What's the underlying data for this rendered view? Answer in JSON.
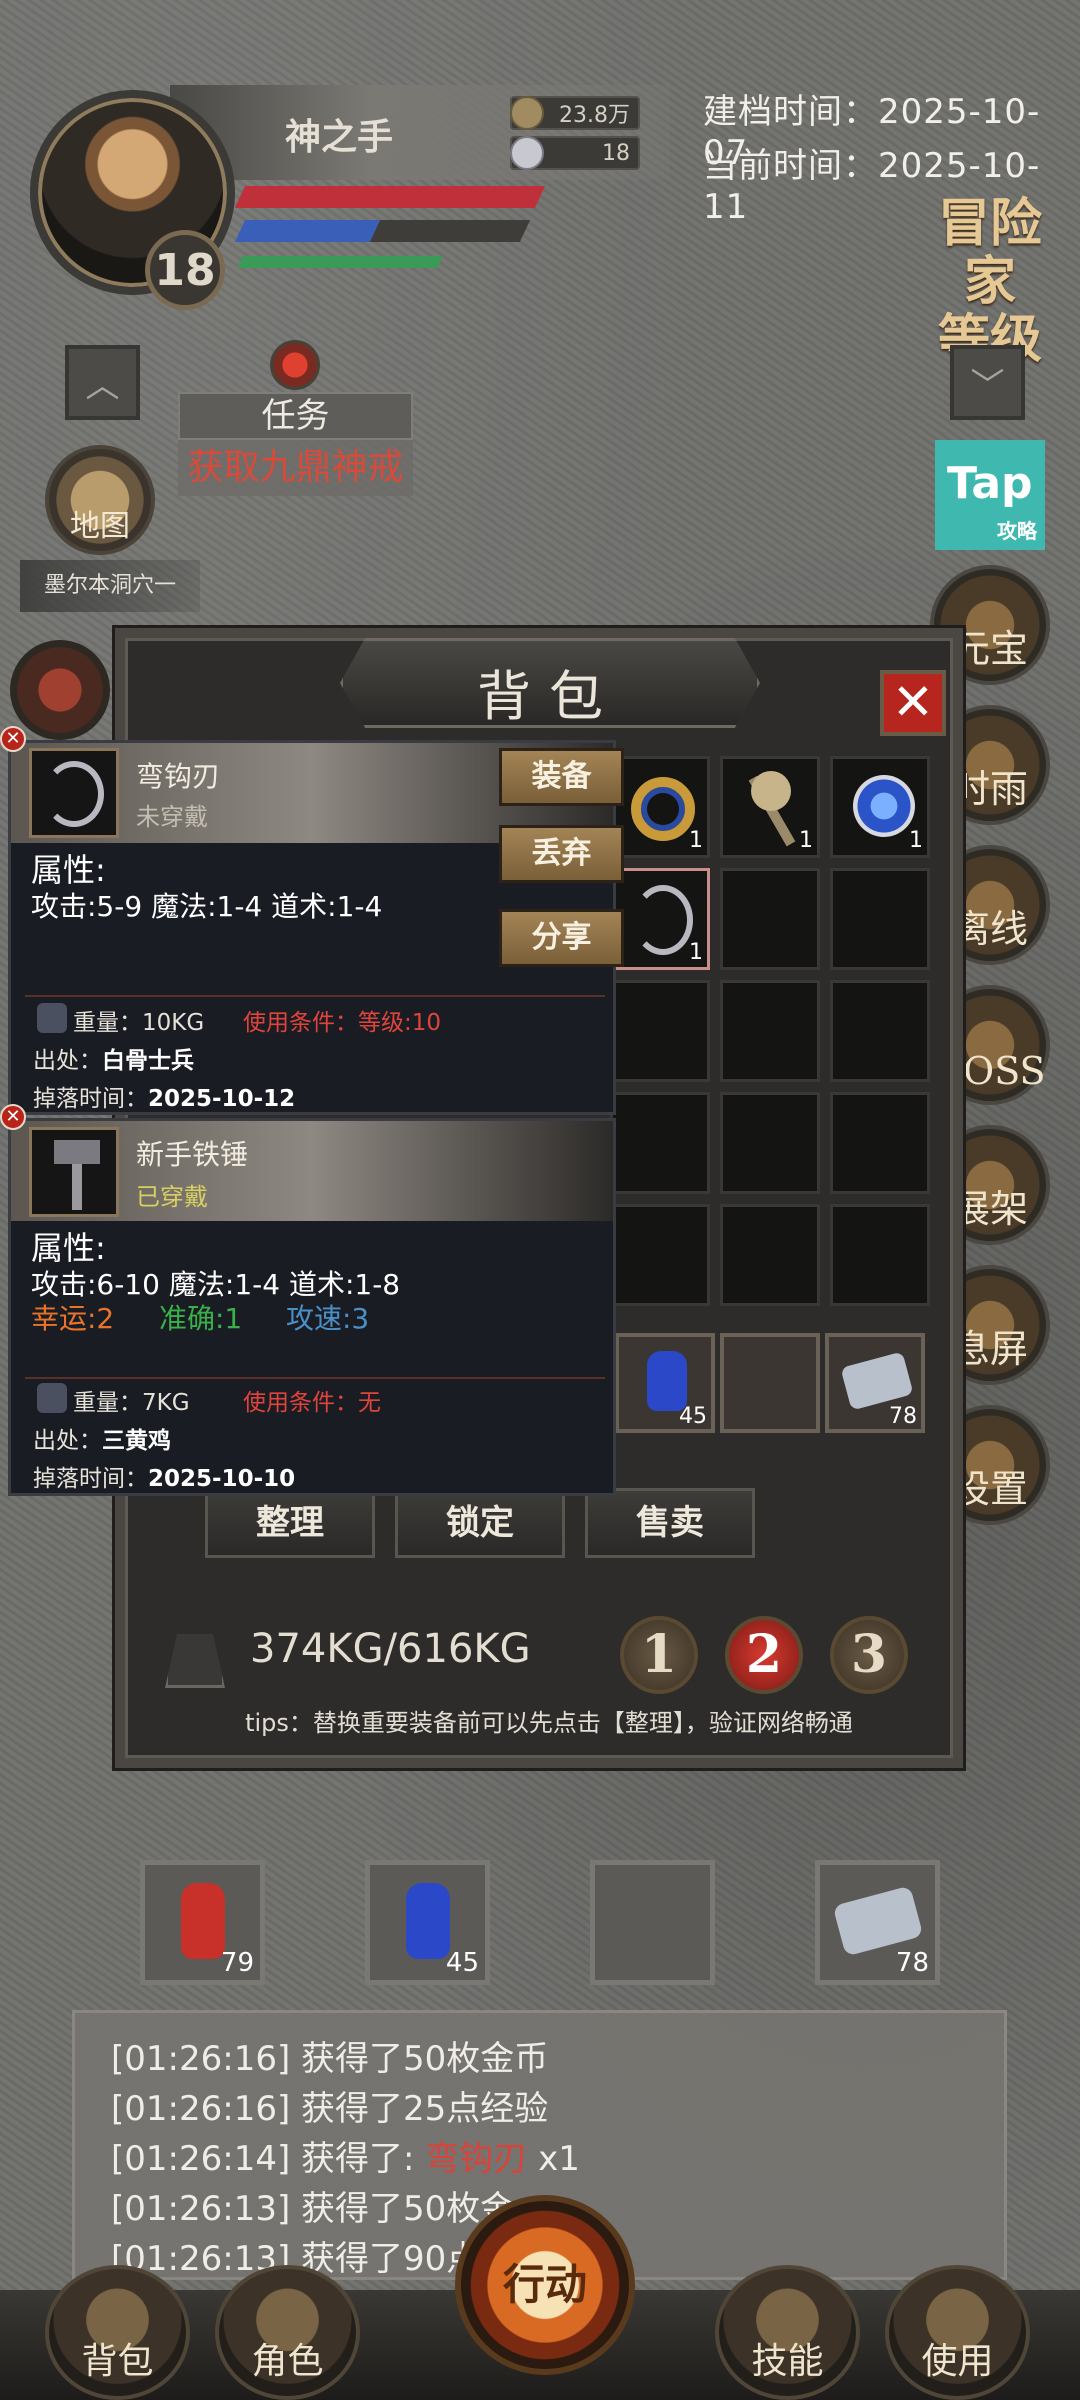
{
  "header": {
    "player_name": "神之手",
    "level": "18",
    "gold": "23.8万",
    "ingots": "18",
    "created_date": "建档时间：2025-10-07",
    "current_date": "当前时间：2025-10-11",
    "adventurer_level_line1": "冒险家",
    "adventurer_level_line2": "等级",
    "bar_colors": {
      "hp": "#c0303a",
      "mp": "#3a5fb8",
      "exp": "#3a9a58"
    }
  },
  "quest": {
    "title": "任务",
    "text": "获取九鼎神戒"
  },
  "map": {
    "label": "地图",
    "location": "墨尔本洞穴一"
  },
  "tap": {
    "logo": "Tap",
    "sub": "攻略"
  },
  "right_menu": [
    "元宝",
    "时雨",
    "离线",
    "BOSS",
    "展架",
    "息屏",
    "设置"
  ],
  "bag": {
    "title": "背包",
    "close": "✕",
    "slot_counts": {
      "ring": "1",
      "axe": "1",
      "orb": "1",
      "hook": "1"
    },
    "quick_slots": {
      "blue_potion": "45",
      "scroll": "78"
    },
    "buttons": {
      "sort": "整理",
      "lock": "锁定",
      "sell": "售卖"
    },
    "weight": "374KG/616KG",
    "pages": [
      "1",
      "2",
      "3"
    ],
    "active_page": 2,
    "tips": "tips：替换重要装备前可以先点击【整理】，验证网络畅通"
  },
  "item1": {
    "name": "弯钩刃",
    "status": "未穿戴",
    "attr_title": "属性:",
    "attrs": "攻击:5-9  魔法:1-4  道术:1-4",
    "weight_label": "重量：",
    "weight": "10KG",
    "requirement": "使用条件：等级:10",
    "source_label": "出处：",
    "source": "白骨士兵",
    "drop_label": "掉落时间：",
    "drop_time": "2025-10-12",
    "buttons": {
      "equip": "装备",
      "discard": "丢弃",
      "share": "分享"
    }
  },
  "item2": {
    "name": "新手铁锤",
    "status": "已穿戴",
    "attr_title": "属性:",
    "attrs": "攻击:6-10  魔法:1-4  道术:1-8",
    "luck": "幸运:2",
    "accuracy": "准确:1",
    "speed": "攻速:3",
    "weight_label": "重量：",
    "weight": "7KG",
    "requirement": "使用条件：无",
    "source_label": "出处：",
    "source": "三黄鸡",
    "drop_label": "掉落时间：",
    "drop_time": "2025-10-10"
  },
  "hotbar": {
    "red_potion": "79",
    "blue_potion": "45",
    "scroll": "78"
  },
  "log": [
    {
      "time": "[01:26:16]",
      "text": "获得了50枚金币"
    },
    {
      "time": "[01:26:16]",
      "text": "获得了25点经验"
    },
    {
      "time": "[01:26:14]",
      "text": "获得了: ",
      "item": "弯钩刃",
      "suffix": " x1"
    },
    {
      "time": "[01:26:13]",
      "text": "获得了50枚金"
    },
    {
      "time": "[01:26:13]",
      "text": "获得了90点"
    }
  ],
  "bottom_nav": {
    "bag": "背包",
    "role": "角色",
    "action": "行动",
    "skill": "技能",
    "use": "使用"
  }
}
